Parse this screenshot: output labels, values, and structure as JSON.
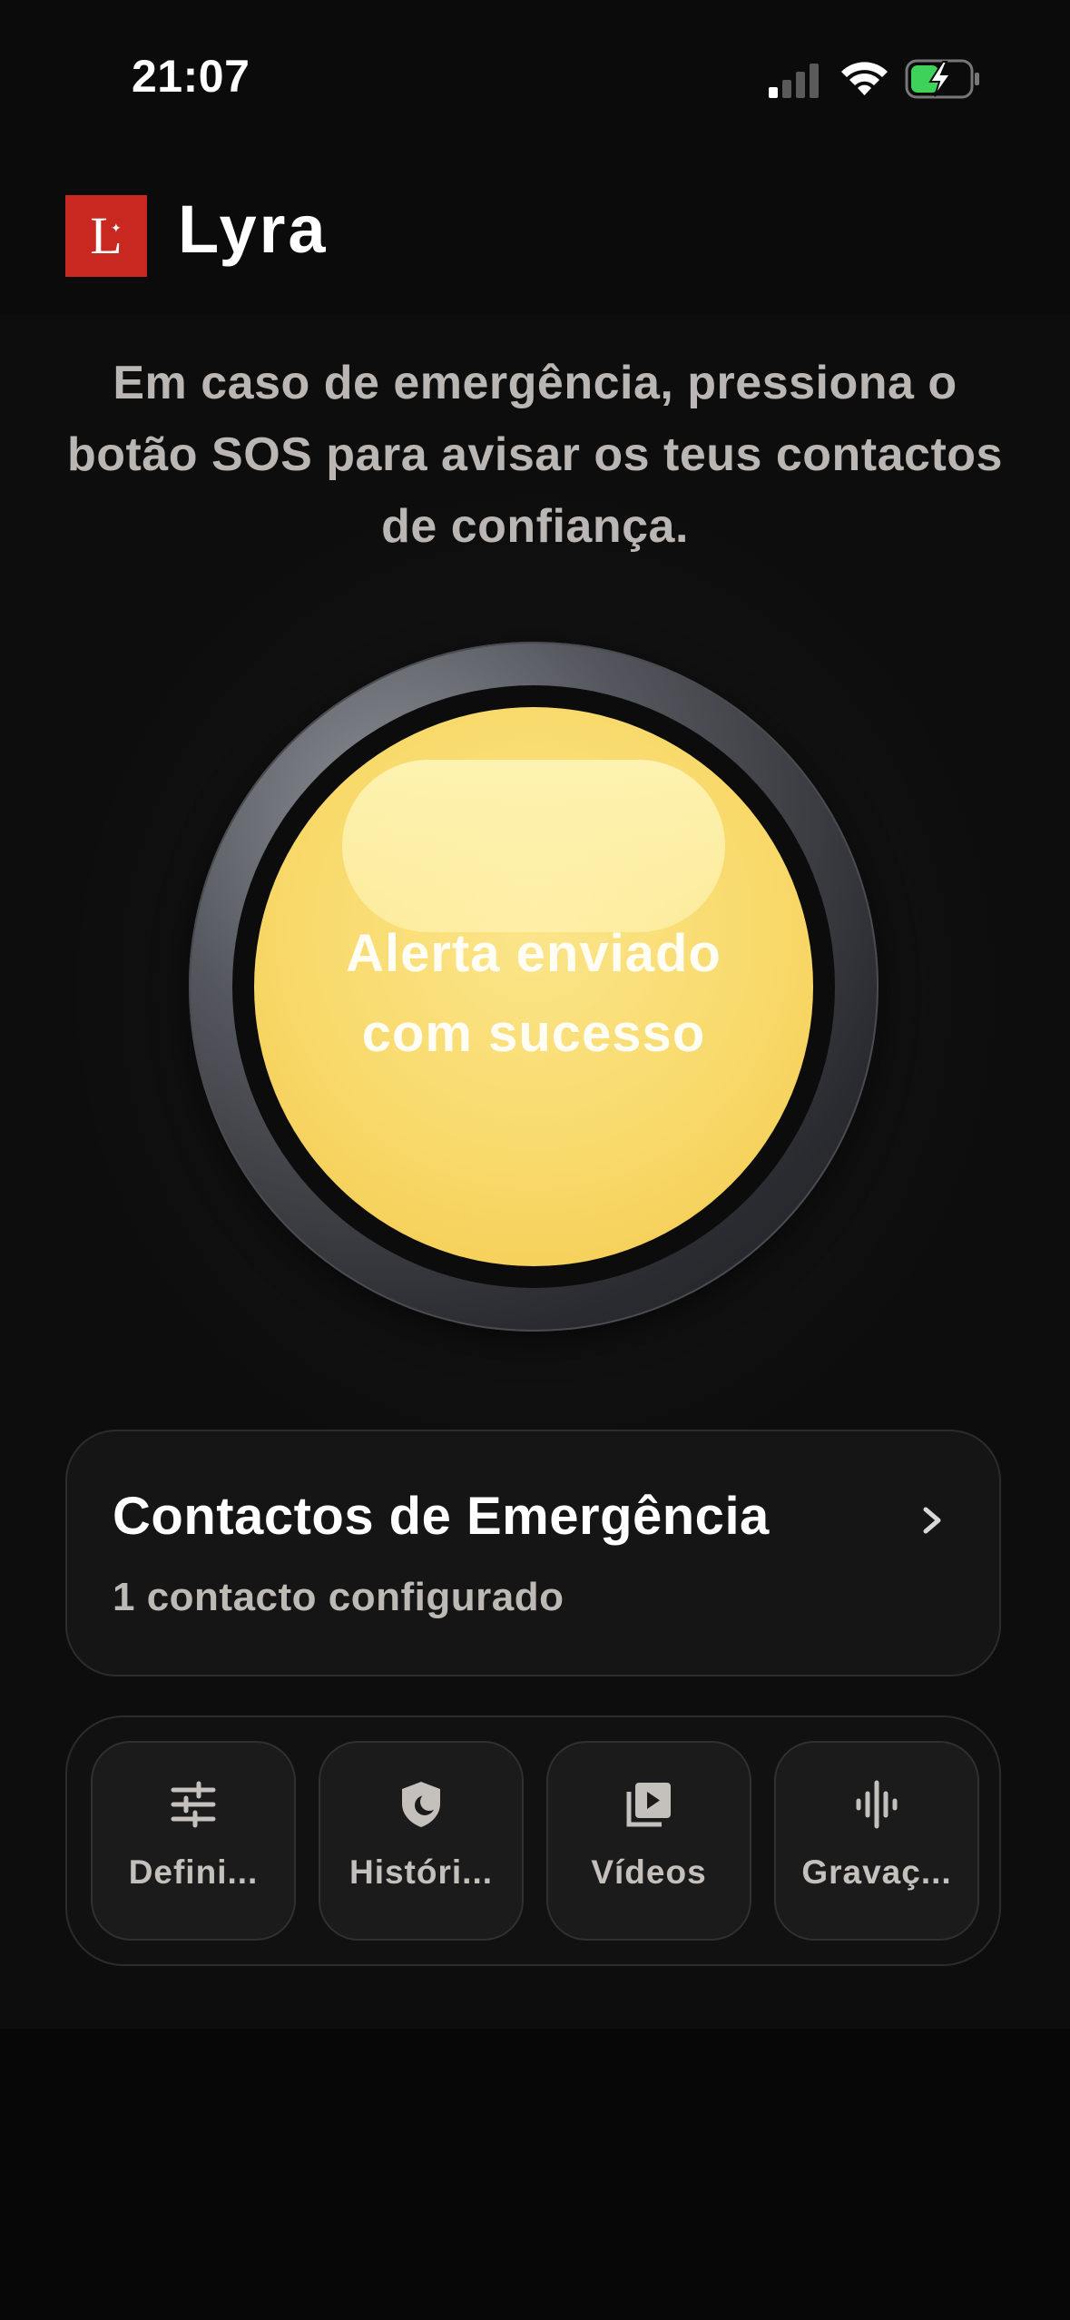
{
  "status_bar": {
    "time": "21:07"
  },
  "app": {
    "logo_letter": "L",
    "title": "Lyra"
  },
  "intro_text": "Em caso de emergência, pressiona o botão SOS para avisar os teus contactos de confiança.",
  "sos_button": {
    "line1": "Alerta enviado",
    "line2": "com sucesso",
    "state_color": "#f8d96a"
  },
  "contacts_card": {
    "title": "Contactos de Emergência",
    "subtitle": "1 contacto configurado"
  },
  "toolbar": {
    "items": [
      {
        "label": "Defini...",
        "icon": "sliders-icon"
      },
      {
        "label": "Históri...",
        "icon": "shield-moon-icon"
      },
      {
        "label": "Vídeos",
        "icon": "video-library-icon"
      },
      {
        "label": "Gravaç...",
        "icon": "audio-waveform-icon"
      }
    ]
  },
  "colors": {
    "brand_red": "#c8281f",
    "background": "#070707"
  }
}
